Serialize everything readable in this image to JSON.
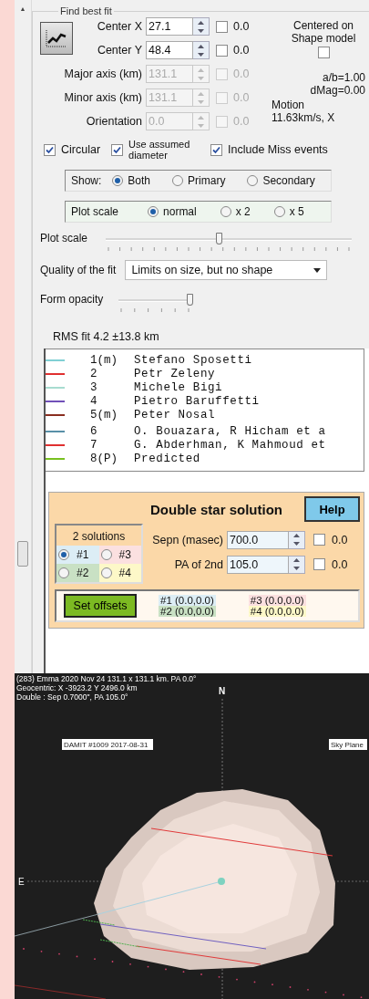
{
  "scroll_arrow": "▲",
  "fit": {
    "title": "Find best fit",
    "fields": [
      {
        "label": "Center X",
        "value": "27.1",
        "disabled": false,
        "checked": false,
        "reading": "0.0"
      },
      {
        "label": "Center Y",
        "value": "48.4",
        "disabled": false,
        "checked": false,
        "reading": "0.0"
      },
      {
        "label": "Major axis (km)",
        "value": "131.1",
        "disabled": true,
        "checked": false,
        "reading": "0.0"
      },
      {
        "label": "Minor axis (km)",
        "value": "131.1",
        "disabled": true,
        "checked": false,
        "reading": "0.0"
      },
      {
        "label": "Orientation",
        "value": "0.0",
        "disabled": true,
        "checked": false,
        "reading": "0.0"
      }
    ],
    "centered": {
      "label": "Centered on Shape model",
      "checked": false
    },
    "info": [
      "a/b=1.00",
      "dMag=0.00"
    ],
    "motion": [
      "Motion",
      "11.63km/s, X"
    ],
    "options": [
      {
        "label": "Circular",
        "checked": true
      },
      {
        "label": "Use assumed diameter",
        "checked": true
      },
      {
        "label": "Include Miss events",
        "checked": true
      }
    ],
    "show": {
      "label": "Show:",
      "options": [
        {
          "label": "Both",
          "selected": true
        },
        {
          "label": "Primary",
          "selected": false
        },
        {
          "label": "Secondary",
          "selected": false
        }
      ]
    },
    "scale": {
      "label": "Plot scale",
      "options": [
        {
          "label": "normal",
          "selected": true
        },
        {
          "label": "x 2",
          "selected": false
        },
        {
          "label": "x 5",
          "selected": false
        }
      ]
    },
    "plot_scale": {
      "label": "Plot scale",
      "level": 0.46
    },
    "quality": {
      "label": "Quality of the fit",
      "value": "Limits on size, but no shape"
    },
    "opacity": {
      "label": "Form opacity",
      "level": 1
    },
    "rms": "RMS fit 4.2 ±13.8 km",
    "observers": [
      {
        "number": "1(m)",
        "name": "Stefano Sposetti",
        "color": "#80d0d4"
      },
      {
        "number": "2",
        "name": "Petr Zeleny",
        "color": "#e03030"
      },
      {
        "number": "3",
        "name": "Michele Bigi",
        "color": "#a8dcd0"
      },
      {
        "number": "4",
        "name": "Pietro Baruffetti",
        "color": "#7050b8"
      },
      {
        "number": "5(m)",
        "name": "Peter Nosal",
        "color": "#8a2e20"
      },
      {
        "number": "6",
        "name": "O. Bouazara, R Hicham et a",
        "color": "#5890a8"
      },
      {
        "number": "7",
        "name": "G. Abderhman, K Mahmoud et",
        "color": "#e03030"
      },
      {
        "number": "8(P)",
        "name": "Predicted",
        "color": "#78c020"
      }
    ],
    "double_star": {
      "title": "Double star solution",
      "help": "Help",
      "solutions_title": "2 solutions",
      "solutions": [
        {
          "label": "#1",
          "selected": true,
          "color": "#dcedf5"
        },
        {
          "label": "#3",
          "selected": false,
          "color": "#fbe0e0"
        },
        {
          "label": "#2",
          "selected": false,
          "color": "#c9e1c4"
        },
        {
          "label": "#4",
          "selected": false,
          "color": "#fdf8c8"
        }
      ],
      "fields": [
        {
          "label": "Sepn (masec)",
          "value": "700.0",
          "checked": false,
          "reading": "0.0"
        },
        {
          "label": "PA of 2nd",
          "value": "105.0",
          "checked": false,
          "reading": "0.0"
        }
      ],
      "set_offsets": "Set offsets",
      "offsets": [
        {
          "label": "#1 (0.0,0.0)",
          "color": "#dcedf5"
        },
        {
          "label": "#3 (0.0,0.0)",
          "color": "#fbe0e0"
        },
        {
          "label": "#2 (0.0,0.0)",
          "color": "#c9e1c4"
        },
        {
          "label": "#4 (0.0,0.0)",
          "color": "#fdf8c8"
        }
      ]
    }
  },
  "plot": {
    "header": [
      "(283) Emma  2020 Nov 24  131.1 x 131.1 km. PA 0.0°",
      "Geocentric: X -3923.2  Y 2496.0 km",
      "Double : Sep 0.7000\", PA 105.0°"
    ],
    "north": "N",
    "east": "E",
    "model_label": "DAMIT #1009 2017-08-31",
    "plane_label": "Sky Plane"
  }
}
